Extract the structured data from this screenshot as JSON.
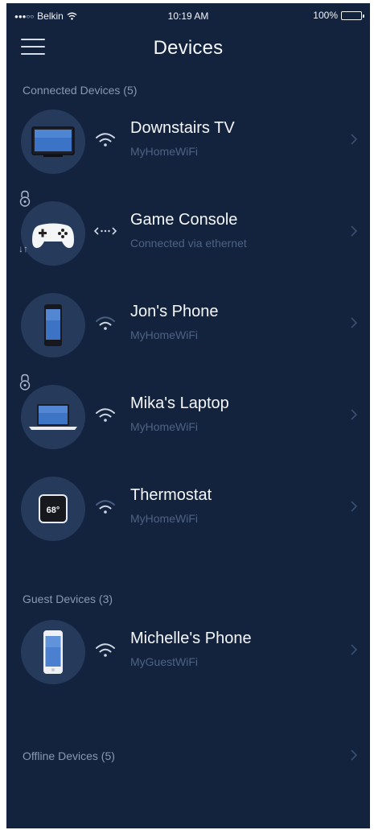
{
  "status_bar": {
    "signal_dots": "●●●○○",
    "carrier": "Belkin",
    "time": "10:19 AM",
    "battery": "100%"
  },
  "header": {
    "title": "Devices",
    "menu_icon": "hamburger-menu-icon"
  },
  "sections": {
    "connected": {
      "label": "Connected Devices (5)"
    },
    "guest": {
      "label": "Guest Devices (3)"
    },
    "offline": {
      "label": "Offline Devices (5)"
    }
  },
  "devices": [
    {
      "name": "Downstairs TV",
      "network": "MyHomeWiFi",
      "icon": "tv-icon",
      "connection": "wifi-icon"
    },
    {
      "name": "Game Console",
      "network": "Connected via ethernet",
      "icon": "gamepad-icon",
      "connection": "ethernet-icon",
      "transfer": "↓↑"
    },
    {
      "name": "Jon's Phone",
      "network": "MyHomeWiFi",
      "icon": "phone-icon",
      "connection": "wifi-icon"
    },
    {
      "name": "Mika's Laptop",
      "network": "MyHomeWiFi",
      "icon": "laptop-icon",
      "connection": "wifi-icon"
    },
    {
      "name": "Thermostat",
      "network": "MyHomeWiFi",
      "icon": "thermostat-icon",
      "connection": "wifi-icon",
      "thermostat_reading": "68°"
    }
  ],
  "guest_devices": [
    {
      "name": "Michelle's Phone",
      "network": "MyGuestWiFi",
      "icon": "phone-icon",
      "connection": "wifi-icon"
    }
  ],
  "colors": {
    "background": "#13233e",
    "avatar": "#263a5c",
    "section_label": "#8a99b2",
    "network_text": "#4e6284",
    "title_text": "#f5f7fa"
  }
}
